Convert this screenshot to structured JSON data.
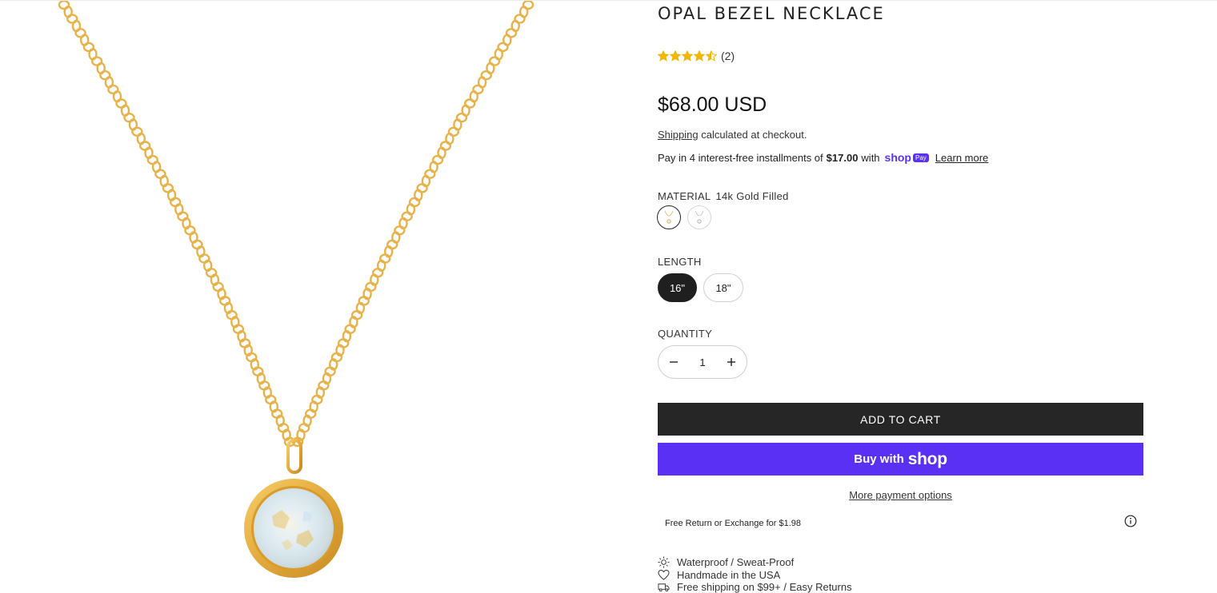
{
  "product": {
    "title": "OPAL BEZEL NECKLACE",
    "rating_value": 4.5,
    "rating_max": 5,
    "review_count": "(2)",
    "price": "$68.00 USD"
  },
  "shipping": {
    "link_label": "Shipping",
    "suffix": "calculated at checkout."
  },
  "installments": {
    "prefix": "Pay in 4 interest-free installments of",
    "amount": "$17.00",
    "with": "with",
    "shop_word": "shop",
    "pay_badge": "Pay",
    "learn_more": "Learn more"
  },
  "material": {
    "label": "MATERIAL",
    "value": "14k Gold Filled"
  },
  "length": {
    "label": "LENGTH",
    "options": [
      "16\"",
      "18\""
    ],
    "selected_index": 0
  },
  "quantity": {
    "label": "QUANTITY",
    "value": "1",
    "minus_icon": "minus-icon",
    "plus_icon": "plus-icon"
  },
  "buttons": {
    "add_to_cart": "ADD TO CART",
    "buy_with": "Buy with",
    "shop_logo": "shop",
    "more_payment": "More payment options"
  },
  "returns": {
    "text": "Free Return or Exchange for $1.98",
    "icon": "info-icon"
  },
  "features": [
    {
      "icon": "sun-icon",
      "text": "Waterproof / Sweat-Proof"
    },
    {
      "icon": "heart-icon",
      "text": "Handmade in the USA"
    },
    {
      "icon": "truck-icon",
      "text": "Free shipping on $99+ / Easy Returns"
    }
  ],
  "colors": {
    "accent": "#5a31f4",
    "dark_button": "#262626",
    "star": "#f2b705",
    "gold_chain": "#e8b24a",
    "opal": "#eef1f2"
  }
}
